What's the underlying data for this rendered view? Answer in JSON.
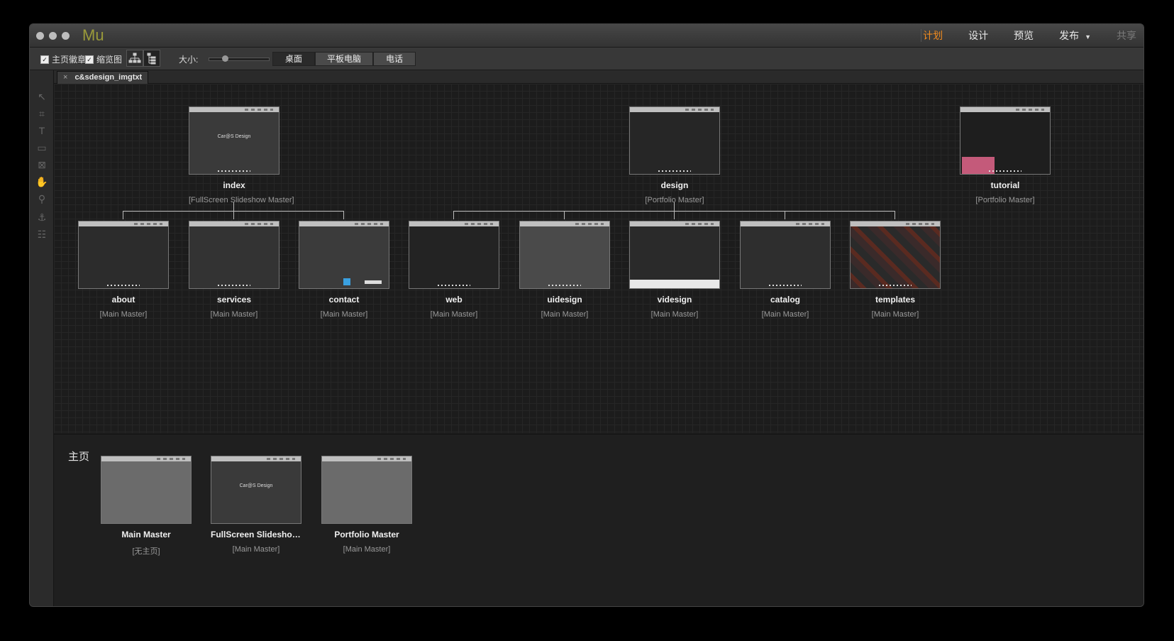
{
  "app": {
    "logo": "Mu"
  },
  "modes": [
    {
      "label": "计划",
      "active": true
    },
    {
      "label": "设计"
    },
    {
      "label": "预览"
    },
    {
      "label": "发布"
    },
    {
      "label": "共享",
      "disabled": true
    }
  ],
  "toolbar": {
    "home_badge_label": "主页徽章",
    "thumbnail_label": "缩览图",
    "size_label": "大小:",
    "size_value": 0.25,
    "layouts": [
      "桌面",
      "平板电脑",
      "电话"
    ],
    "active_layout": "桌面"
  },
  "tab": {
    "close": "×",
    "title": "c&sdesign_imgtxt"
  },
  "top_pages": [
    {
      "name": "index",
      "master": "[FullScreen Slideshow Master]",
      "hero": "Car@S Design",
      "hero_accent": "Design"
    },
    {
      "name": "design",
      "master": "[Portfolio Master]"
    },
    {
      "name": "tutorial",
      "master": "[Portfolio Master]"
    }
  ],
  "child_pages": [
    {
      "name": "about",
      "master": "[Main Master]"
    },
    {
      "name": "services",
      "master": "[Main Master]"
    },
    {
      "name": "contact",
      "master": "[Main Master]"
    },
    {
      "name": "web",
      "master": "[Main Master]"
    },
    {
      "name": "uidesign",
      "master": "[Main Master]"
    },
    {
      "name": "videsign",
      "master": "[Main Master]"
    },
    {
      "name": "catalog",
      "master": "[Main Master]"
    },
    {
      "name": "templates",
      "master": "[Main Master]"
    }
  ],
  "masters": {
    "title": "主页",
    "items": [
      {
        "name": "Main Master",
        "master": "[无主页]"
      },
      {
        "name": "FullScreen Slideshow Ma...",
        "master": "[Main Master]",
        "hero": "Car@S Design"
      },
      {
        "name": "Portfolio Master",
        "master": "[Main Master]"
      }
    ]
  },
  "colors": {
    "accent": "#f08a1e",
    "logo": "#9a9a3a",
    "hero_green": "#7dc242"
  },
  "icons": [
    "select-arrow-icon",
    "crop-icon",
    "text-icon",
    "rectangle-icon",
    "image-frame-icon",
    "hand-icon",
    "zoom-icon",
    "anchor-icon",
    "widget-icon",
    "sitemap-view-icon",
    "list-view-icon"
  ]
}
